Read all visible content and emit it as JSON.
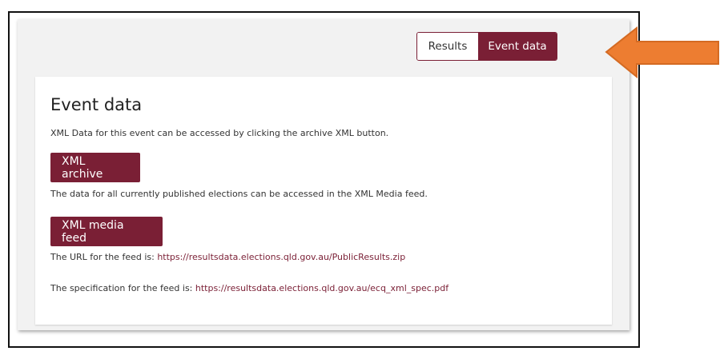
{
  "toggle": {
    "results_label": "Results",
    "event_label": "Event data"
  },
  "event": {
    "heading": "Event data",
    "intro": "XML Data for this event can be accessed by clicking the archive XML button.",
    "archive_button": "XML archive",
    "published_text": "The data for all currently published elections can be accessed in the XML Media feed.",
    "media_button": "XML media feed",
    "feed_url_prefix": "The URL for the feed is: ",
    "feed_url": "https://resultsdata.elections.qld.gov.au/PublicResults.zip",
    "spec_prefix": "The specification for the feed is: ",
    "spec_url": "https://resultsdata.elections.qld.gov.au/ecq_xml_spec.pdf"
  },
  "annotation": {
    "arrow_color": "#ed7d31"
  },
  "colors": {
    "accent": "#7a1f35",
    "panel_bg": "#f2f2f2"
  }
}
